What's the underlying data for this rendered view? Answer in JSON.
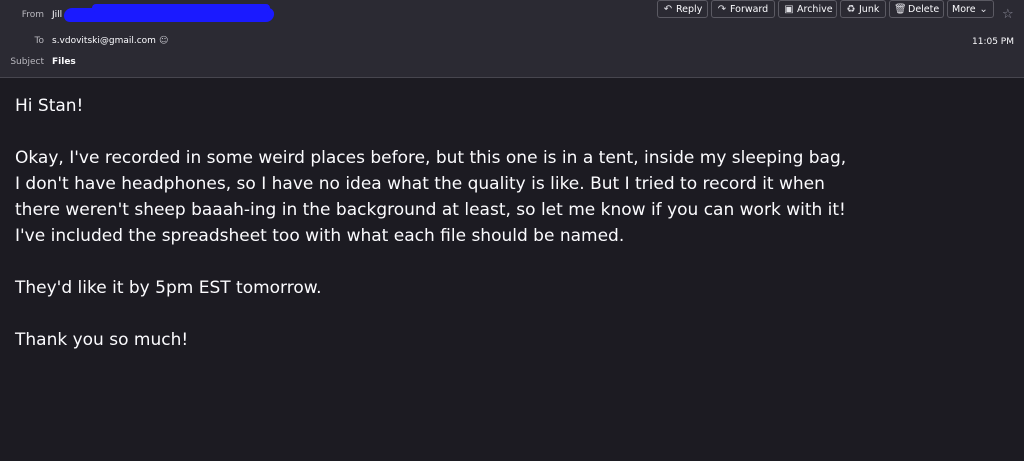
{
  "header": {
    "from_label": "From",
    "from_name": "Jill",
    "to_label": "To",
    "to_address": "s.vdovitski@gmail.com",
    "subject_label": "Subject",
    "subject": "Files",
    "time": "11:05 PM"
  },
  "toolbar": {
    "reply": "Reply",
    "forward": "Forward",
    "archive": "Archive",
    "junk": "Junk",
    "delete": "Delete",
    "more": "More"
  },
  "message": {
    "greeting": "Hi Stan!",
    "p1_l1": "Okay, I've recorded in some weird places before, but this one is in a tent, inside my sleeping bag,",
    "p1_l2": "I don't have headphones, so I have no idea what the quality is like. But I tried  to record it when",
    "p1_l3": "there weren't sheep baaah-ing in the background at least, so let me know if you  can work with it!",
    "p1_l4": "I've included the spreadsheet too with what each file should be named.",
    "p2": "They'd like it by 5pm EST tomorrow.",
    "p3": "Thank you so much!"
  }
}
